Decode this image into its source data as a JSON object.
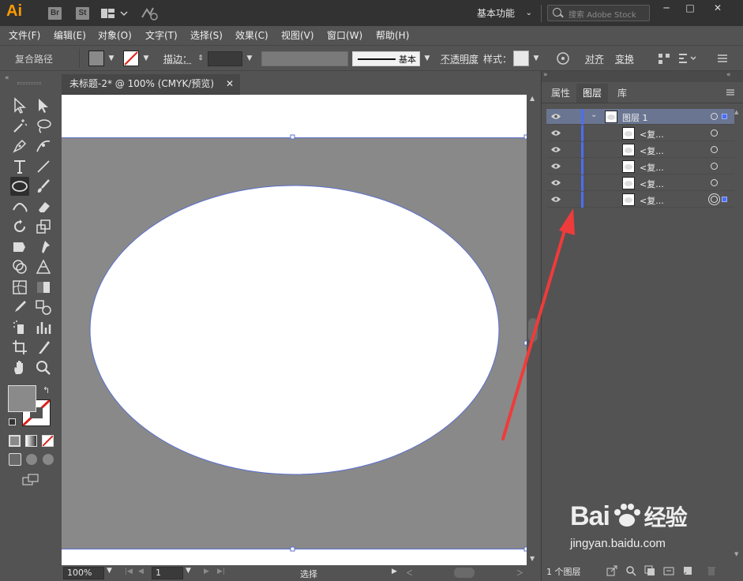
{
  "titlebar": {
    "app_logo": "Ai",
    "bridge_badge": "Br",
    "stock_badge": "St",
    "workspace": "基本功能",
    "search_placeholder": "搜索 Adobe Stock"
  },
  "menu": [
    "文件(F)",
    "编辑(E)",
    "对象(O)",
    "文字(T)",
    "选择(S)",
    "效果(C)",
    "视图(V)",
    "窗口(W)",
    "帮助(H)"
  ],
  "controlbar": {
    "selection_type": "复合路径",
    "stroke_label": "描边：",
    "stroke_profile": "基本",
    "opacity_label": "不透明度",
    "style_label": "样式：",
    "align_label": "对齐",
    "transform_label": "变换",
    "fill_color": "#8a8a8a"
  },
  "document": {
    "tab_title": "未标题-2* @ 100% (CMYK/预览)",
    "artboard_fill": "#898989",
    "ellipse_fill": "#ffffff",
    "selection_color": "#5b6fcf"
  },
  "statusbar": {
    "zoom": "100%",
    "artboard_num": "1",
    "tool_status": "选择"
  },
  "layers_panel": {
    "tabs": [
      "属性",
      "图层",
      "库"
    ],
    "active_tab": "图层",
    "layers": [
      {
        "name": "图层 1",
        "selected": true
      },
      {
        "name": "<复...",
        "selected": false
      },
      {
        "name": "<复...",
        "selected": false
      },
      {
        "name": "<复...",
        "selected": false
      },
      {
        "name": "<复...",
        "selected": false
      },
      {
        "name": "<复...",
        "selected": false
      }
    ],
    "footer_count": "1 个图层"
  },
  "watermark": {
    "logo_text": "Bai",
    "logo_text2": "经验",
    "url": "jingyan.baidu.com"
  }
}
